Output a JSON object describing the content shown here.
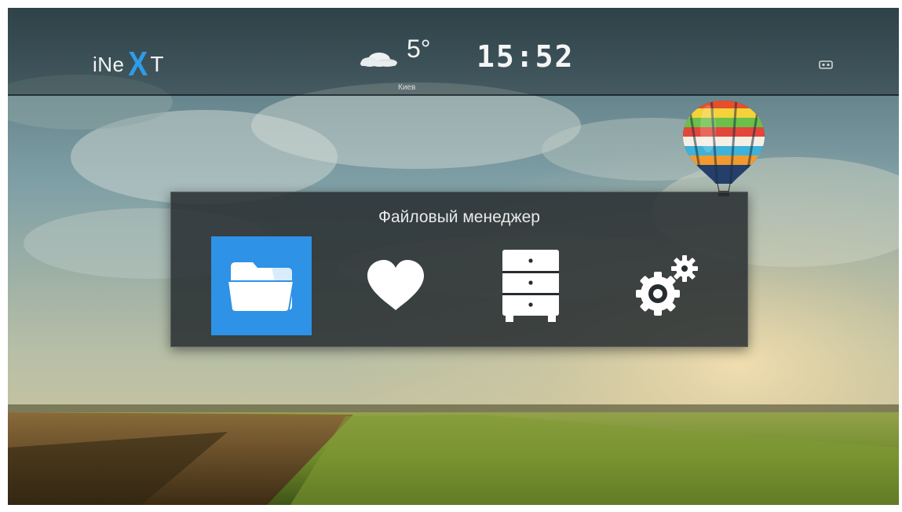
{
  "header": {
    "logo": {
      "prefix": "iNe",
      "accent": "X",
      "suffix": "T",
      "accent_color": "#2f9ce8"
    },
    "weather": {
      "icon": "cloud-icon",
      "temperature": "5°",
      "city": "Киев"
    },
    "clock": "15:52",
    "status_icon": "network-icon"
  },
  "menu": {
    "title": "Файловый менеджер",
    "items": [
      {
        "icon": "folder-icon",
        "selected": true
      },
      {
        "icon": "heart-icon",
        "selected": false
      },
      {
        "icon": "drawer-cabinet-icon",
        "selected": false
      },
      {
        "icon": "gears-icon",
        "selected": false
      }
    ],
    "selected_color": "#2e92e6"
  }
}
